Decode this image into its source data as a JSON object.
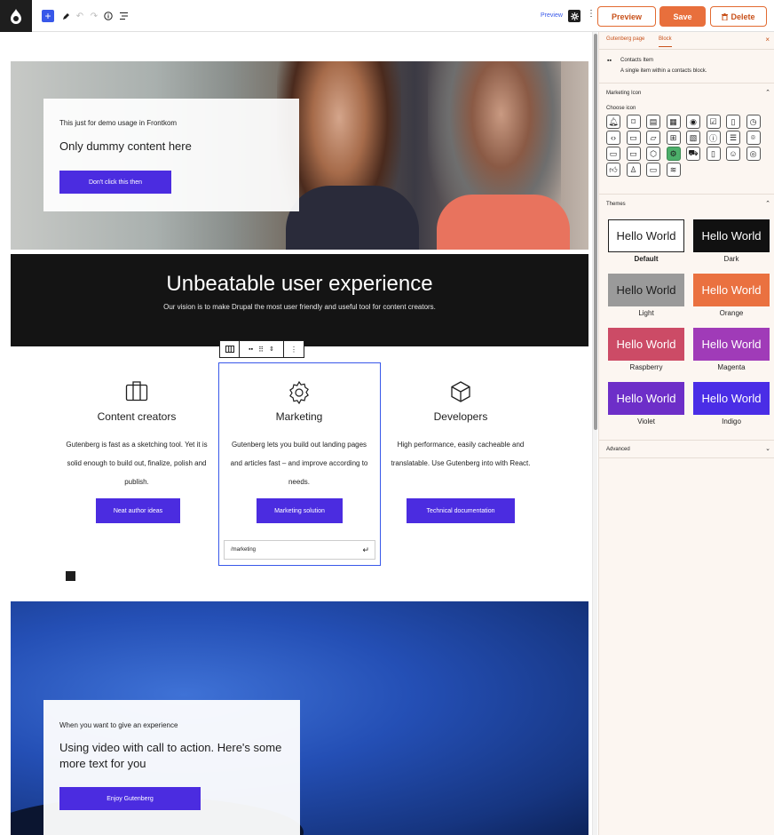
{
  "toolbar": {
    "preview_link": "Preview",
    "preview_button": "Preview",
    "save_button": "Save",
    "delete_button": "Delete"
  },
  "hero": {
    "eyebrow": "This just for demo usage in Frontkom",
    "title": "Only dummy content here",
    "button": "Don't click this then"
  },
  "banner": {
    "title": "Unbeatable user experience",
    "subtitle": "Our vision is to make Drupal the most user friendly and useful tool for content creators."
  },
  "columns": [
    {
      "icon": "briefcase-icon",
      "title": "Content creators",
      "desc": "Gutenberg is fast as a sketching tool. Yet it is solid enough to build out, finalize, polish and publish.",
      "button": "Neat author ideas"
    },
    {
      "icon": "gear-icon",
      "title": "Marketing",
      "desc": "Gutenberg lets you build out landing pages and articles fast – and improve according to needs.",
      "button": "Marketing solution"
    },
    {
      "icon": "cube-icon",
      "title": "Developers",
      "desc": "High performance, easily cacheable and translatable. Use Gutenberg into with React.",
      "button": "Technical documentation"
    }
  ],
  "url_input": "/marketing",
  "video": {
    "eyebrow": "When you want to give an experience",
    "title": "Using video with call to action. Here's some more text for you",
    "button": "Enjoy Gutenberg"
  },
  "sidebar": {
    "tab_page": "Gutenberg page",
    "tab_block": "Block",
    "block_name": "Contacts Item",
    "block_desc": "A single item within a contacts block.",
    "marketing_icon_title": "Marketing Icon",
    "choose_icon": "Choose icon",
    "icons": [
      "bell-icon",
      "bookmark-icon",
      "briefcase-icon",
      "calendar-icon",
      "camera-icon",
      "checkbox-icon",
      "clipboard-icon",
      "clock-icon",
      "code-icon",
      "document-icon",
      "folder-icon",
      "gift-icon",
      "image-icon",
      "info-icon",
      "list-icon",
      "location-icon",
      "chat-icon",
      "monitor-icon",
      "cube-icon",
      "gear-icon",
      "cart-icon",
      "phone-icon",
      "smiley-icon",
      "target-icon",
      "thumbs-up-icon",
      "user-icon",
      "video-icon",
      "wifi-icon"
    ],
    "selected_icon": "gear-icon",
    "themes_title": "Themes",
    "themes": [
      {
        "sample": "Hello World",
        "label": "Default",
        "bg": "#ffffff",
        "fg": "#1e1e1e"
      },
      {
        "sample": "Hello World",
        "label": "Dark",
        "bg": "#111111",
        "fg": "#ffffff"
      },
      {
        "sample": "Hello World",
        "label": "Light",
        "bg": "#9a9a9a",
        "fg": "#1e1e1e"
      },
      {
        "sample": "Hello World",
        "label": "Orange",
        "bg": "#ea7140",
        "fg": "#ffffff"
      },
      {
        "sample": "Hello World",
        "label": "Raspberry",
        "bg": "#cc4b66",
        "fg": "#ffffff"
      },
      {
        "sample": "Hello World",
        "label": "Magenta",
        "bg": "#a03bb8",
        "fg": "#ffffff"
      },
      {
        "sample": "Hello World",
        "label": "Violet",
        "bg": "#6d2ec8",
        "fg": "#ffffff"
      },
      {
        "sample": "Hello World",
        "label": "Indigo",
        "bg": "#4a2de6",
        "fg": "#ffffff"
      }
    ],
    "advanced_title": "Advanced"
  }
}
